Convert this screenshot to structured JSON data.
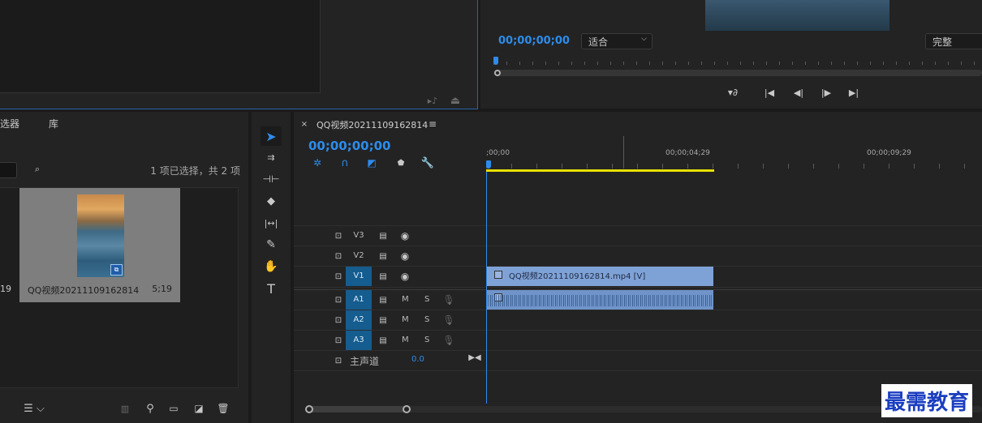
{
  "source_monitor": {
    "icons": [
      "insert-icon",
      "overwrite-icon"
    ]
  },
  "program_monitor": {
    "timecode": "00;00;00;00",
    "fit_select": "适合",
    "quality_select": "完整"
  },
  "project": {
    "tabs": [
      "选器",
      "库"
    ],
    "selection_status": "1 项已选择，共 2 项",
    "left_item_duration": "19",
    "item_name": "QQ视频20211109162814",
    "item_duration": "5;19"
  },
  "sequence": {
    "name": "QQ视频20211109162814",
    "timecode": "00;00;00;00",
    "ruler_labels": [
      ";00;00",
      "00;00;04;29",
      "00;00;09;29"
    ],
    "tracks": {
      "video": [
        {
          "label": "V3",
          "selected": false
        },
        {
          "label": "V2",
          "selected": false
        },
        {
          "label": "V1",
          "selected": true
        }
      ],
      "audio": [
        {
          "label": "A1",
          "m": "M",
          "s": "S"
        },
        {
          "label": "A2",
          "m": "M",
          "s": "S"
        },
        {
          "label": "A3",
          "m": "M",
          "s": "S"
        }
      ],
      "master": {
        "label": "主声道",
        "value": "0.0"
      }
    },
    "video_clip": "QQ视频20211109162814.mp4 [V]"
  },
  "watermark": "最需教育",
  "colors": {
    "accent": "#2d8ceb",
    "clip_video": "#7fa2d6",
    "clip_audio": "#6f94c9",
    "work_area": "#e8e000"
  }
}
